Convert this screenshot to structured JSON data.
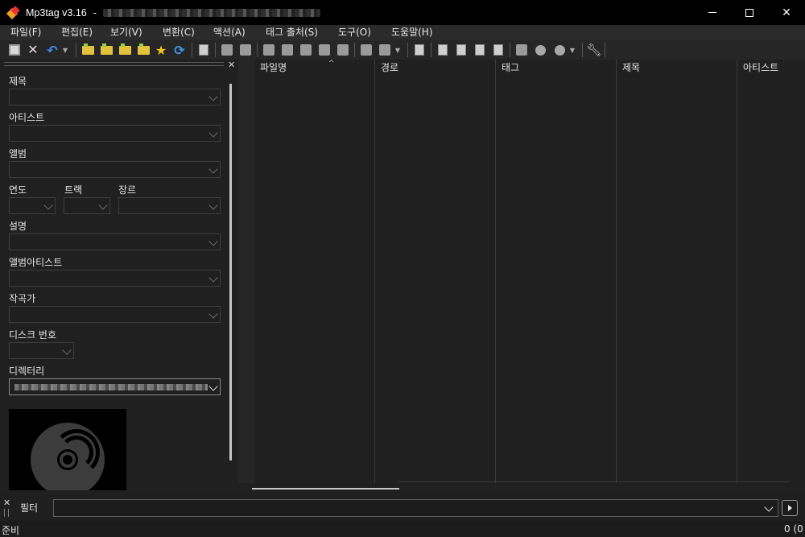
{
  "window": {
    "title": "Mp3tag v3.16",
    "title_separator": "-",
    "controls": {
      "minimize": "minimize",
      "maximize": "maximize",
      "close": "✕"
    }
  },
  "menu": [
    {
      "label": "파일(F)"
    },
    {
      "label": "편집(E)"
    },
    {
      "label": "보기(V)"
    },
    {
      "label": "변환(C)"
    },
    {
      "label": "액션(A)"
    },
    {
      "label": "태그 출처(S)"
    },
    {
      "label": "도구(O)"
    },
    {
      "label": "도움말(H)"
    }
  ],
  "toolbar_icons": [
    "save-icon",
    "remove-tag-icon",
    "undo-icon",
    "add-directory-icon",
    "change-directory-icon",
    "add-folder-icon",
    "favorite-icon",
    "refresh-icon",
    "extended-tags-icon",
    "print-icon",
    "export-icon",
    "tag-to-filename-icon",
    "filename-to-tag-icon",
    "tag-to-tag-icon",
    "text-file-to-tag-icon",
    "autonumber-icon",
    "replace-icon",
    "case-conversion-icon",
    "actions-icon",
    "playlist-icon",
    "web-sources-icon",
    "settings-icon"
  ],
  "tag_panel": {
    "close_label": "✕",
    "fields": {
      "title": "제목",
      "artist": "아티스트",
      "album": "앨범",
      "year": "연도",
      "track": "트랙",
      "genre": "장르",
      "comment": "설명",
      "album_artist": "앨범아티스트",
      "composer": "작곡가",
      "disc_number": "디스크 번호",
      "directory": "디렉터리"
    }
  },
  "file_list": {
    "columns": [
      "파일명",
      "경로",
      "태그",
      "제목",
      "아티스트"
    ],
    "rows": []
  },
  "filter": {
    "close_label": "✕",
    "label": "필터",
    "value": ""
  },
  "status": {
    "left": "준비",
    "right": "0 (0"
  }
}
